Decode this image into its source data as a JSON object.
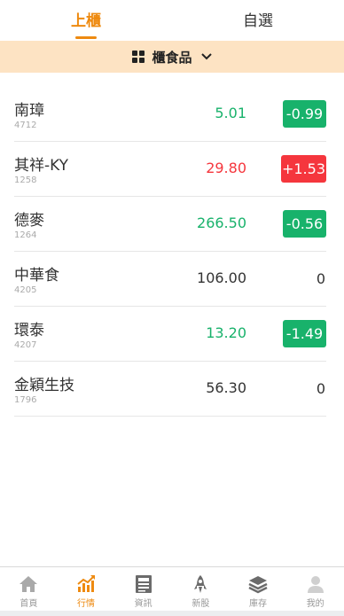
{
  "tabs": [
    {
      "label": "上櫃",
      "active": true
    },
    {
      "label": "自選",
      "active": false
    }
  ],
  "category": {
    "label": "櫃食品",
    "icon": "grid-icon",
    "dropdown_icon": "chevron-down-icon"
  },
  "colors": {
    "accent": "#ee8a10",
    "up": "#f5363d",
    "down": "#18b26b",
    "category_bg": "#fde3c3"
  },
  "stocks": [
    {
      "name": "南璋",
      "code": "4712",
      "price": "5.01",
      "change": "-0.99",
      "direction": "down"
    },
    {
      "name": "其祥-KY",
      "code": "1258",
      "price": "29.80",
      "change": "+1.53",
      "direction": "up"
    },
    {
      "name": "德麥",
      "code": "1264",
      "price": "266.50",
      "change": "-0.56",
      "direction": "down"
    },
    {
      "name": "中華食",
      "code": "4205",
      "price": "106.00",
      "change": "0",
      "direction": "flat"
    },
    {
      "name": "環泰",
      "code": "4207",
      "price": "13.20",
      "change": "-1.49",
      "direction": "down"
    },
    {
      "name": "金穎生技",
      "code": "1796",
      "price": "56.30",
      "change": "0",
      "direction": "flat"
    }
  ],
  "nav": [
    {
      "label": "首頁",
      "icon": "home-icon",
      "active": false
    },
    {
      "label": "行情",
      "icon": "chart-icon",
      "active": true
    },
    {
      "label": "資訊",
      "icon": "news-icon",
      "active": false
    },
    {
      "label": "新股",
      "icon": "rocket-icon",
      "active": false
    },
    {
      "label": "庫存",
      "icon": "layers-icon",
      "active": false
    },
    {
      "label": "我的",
      "icon": "user-icon",
      "active": false
    }
  ]
}
